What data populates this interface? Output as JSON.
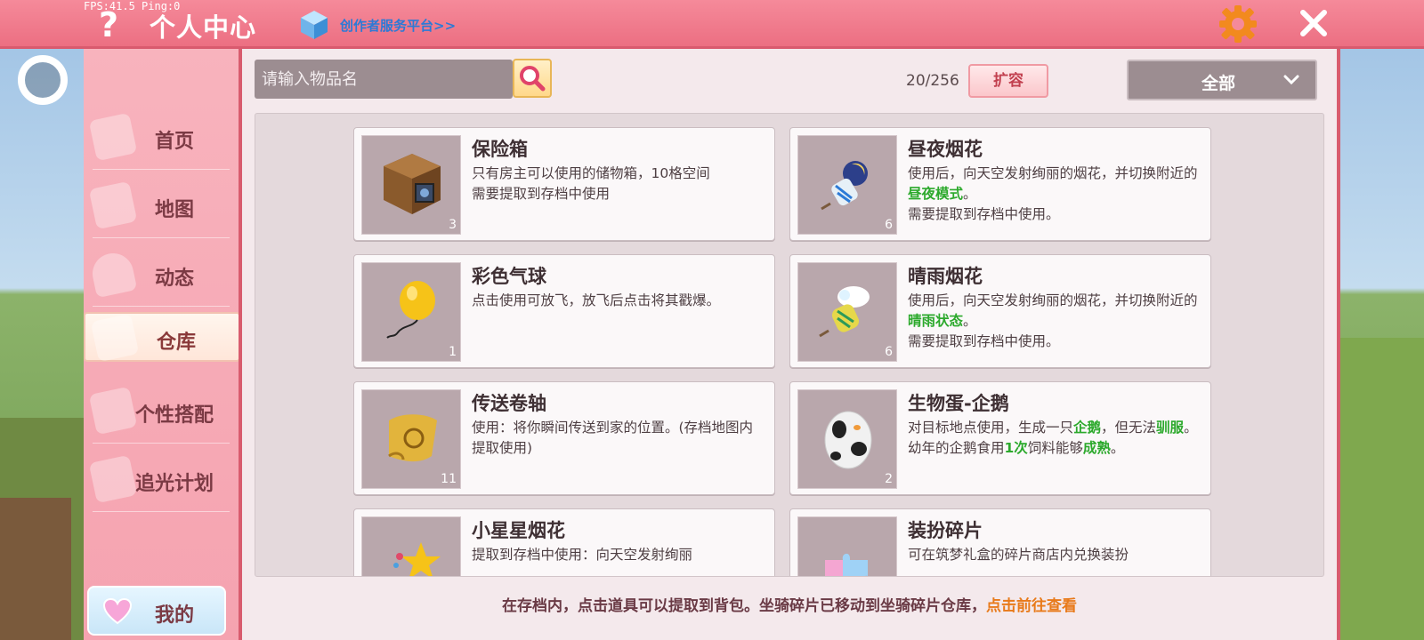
{
  "hud": {
    "fps": "FPS:41.5  Ping:0"
  },
  "header": {
    "title": "个人中心",
    "creator_link": "创作者服务平台>>"
  },
  "sidebar": {
    "items": [
      {
        "label": "首页"
      },
      {
        "label": "地图"
      },
      {
        "label": "动态"
      },
      {
        "label": "仓库"
      },
      {
        "label": "个性搭配"
      },
      {
        "label": "追光计划"
      }
    ],
    "active": "仓库",
    "mine_label": "我的"
  },
  "warehouse": {
    "search_placeholder": "请输入物品名",
    "capacity": "20/256",
    "expand_label": "扩容",
    "filter_value": "全部",
    "items": [
      {
        "name": "保险箱",
        "qty": "3",
        "icon": "chest-icon",
        "desc": [
          "只有房主可以使用的储物箱，10格空间",
          "需要提取到存档中使用"
        ]
      },
      {
        "name": "昼夜烟花",
        "qty": "6",
        "icon": "firework-icon",
        "desc_pre": "使用后，向天空发射绚丽的烟花，并切换附近的",
        "desc_hl": "昼夜模式",
        "desc_post": "。",
        "desc_2": "需要提取到存档中使用。"
      },
      {
        "name": "彩色气球",
        "qty": "1",
        "icon": "balloon-icon",
        "desc": [
          "点击使用可放飞，放飞后点击将其戳爆。"
        ]
      },
      {
        "name": "晴雨烟花",
        "qty": "6",
        "icon": "firework-icon",
        "desc_pre": "使用后，向天空发射绚丽的烟花，并切换附近的",
        "desc_hl": "晴雨状态",
        "desc_post": "。",
        "desc_2": "需要提取到存档中使用。"
      },
      {
        "name": "传送卷轴",
        "qty": "11",
        "icon": "scroll-icon",
        "desc": [
          "使用：将你瞬间传送到家的位置。(存档地图内提取使用)"
        ]
      },
      {
        "name": "生物蛋-企鹅",
        "qty": "2",
        "icon": "egg-icon",
        "d1": "对目标地点使用，生成一只",
        "d1_hl": "企鹅",
        "d1_b": "，但无法",
        "d1_hl2": "驯服",
        "d1_c": "。",
        "d2": "幼年的企鹅食用",
        "d2_hl": "1次",
        "d2_b": "饲料能够",
        "d2_hl2": "成熟",
        "d2_c": "。"
      },
      {
        "name": "小星星烟花",
        "qty": "",
        "icon": "star-icon",
        "desc": [
          "提取到存档中使用：向天空发射绚丽"
        ]
      },
      {
        "name": "装扮碎片",
        "qty": "",
        "icon": "puzzle-icon",
        "desc": [
          "可在筑梦礼盒的碎片商店内兑换装扮"
        ]
      }
    ],
    "footer_text": "在存档内，点击道具可以提取到背包。坐骑碎片已移动到坐骑碎片仓库，",
    "footer_link": "点击前往查看"
  },
  "colors": {
    "accent": "#ec6f82",
    "highlight": "#2ca92c",
    "link": "#e87a1a"
  }
}
